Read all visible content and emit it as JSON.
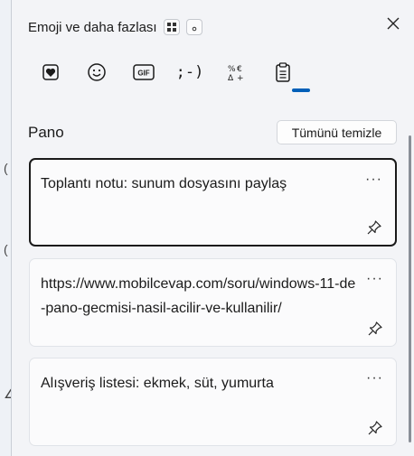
{
  "header": {
    "title": "Emoji ve daha fazlası",
    "close_icon": "close-icon",
    "grid_icon": "grid-icon",
    "dot_icon": "dot-icon"
  },
  "tabs": [
    {
      "name": "favorites-heart",
      "icon": "heart-icon"
    },
    {
      "name": "emoji",
      "icon": "smiley-icon"
    },
    {
      "name": "gif",
      "icon": "gif-icon",
      "label": "GIF"
    },
    {
      "name": "kaomoji",
      "icon": "kaomoji-icon",
      "label": ";-)"
    },
    {
      "name": "symbols",
      "icon": "symbols-icon"
    },
    {
      "name": "clipboard",
      "icon": "clipboard-icon",
      "selected": true
    }
  ],
  "clipboard": {
    "section_title": "Pano",
    "clear_all_label": "Tümünü temizle",
    "items": [
      {
        "text": "Toplantı notu: sunum dosyasını paylaş",
        "selected": true
      },
      {
        "text": "https://www.mobilcevap.com/soru/windows-11-de-pano-gecmisi-nasil-acilir-ve-kullanilir/",
        "selected": false
      },
      {
        "text": "Alışveriş listesi: ekmek, süt, yumurta",
        "selected": false
      }
    ],
    "more_label": "···"
  },
  "accent_color": "#005fb8"
}
